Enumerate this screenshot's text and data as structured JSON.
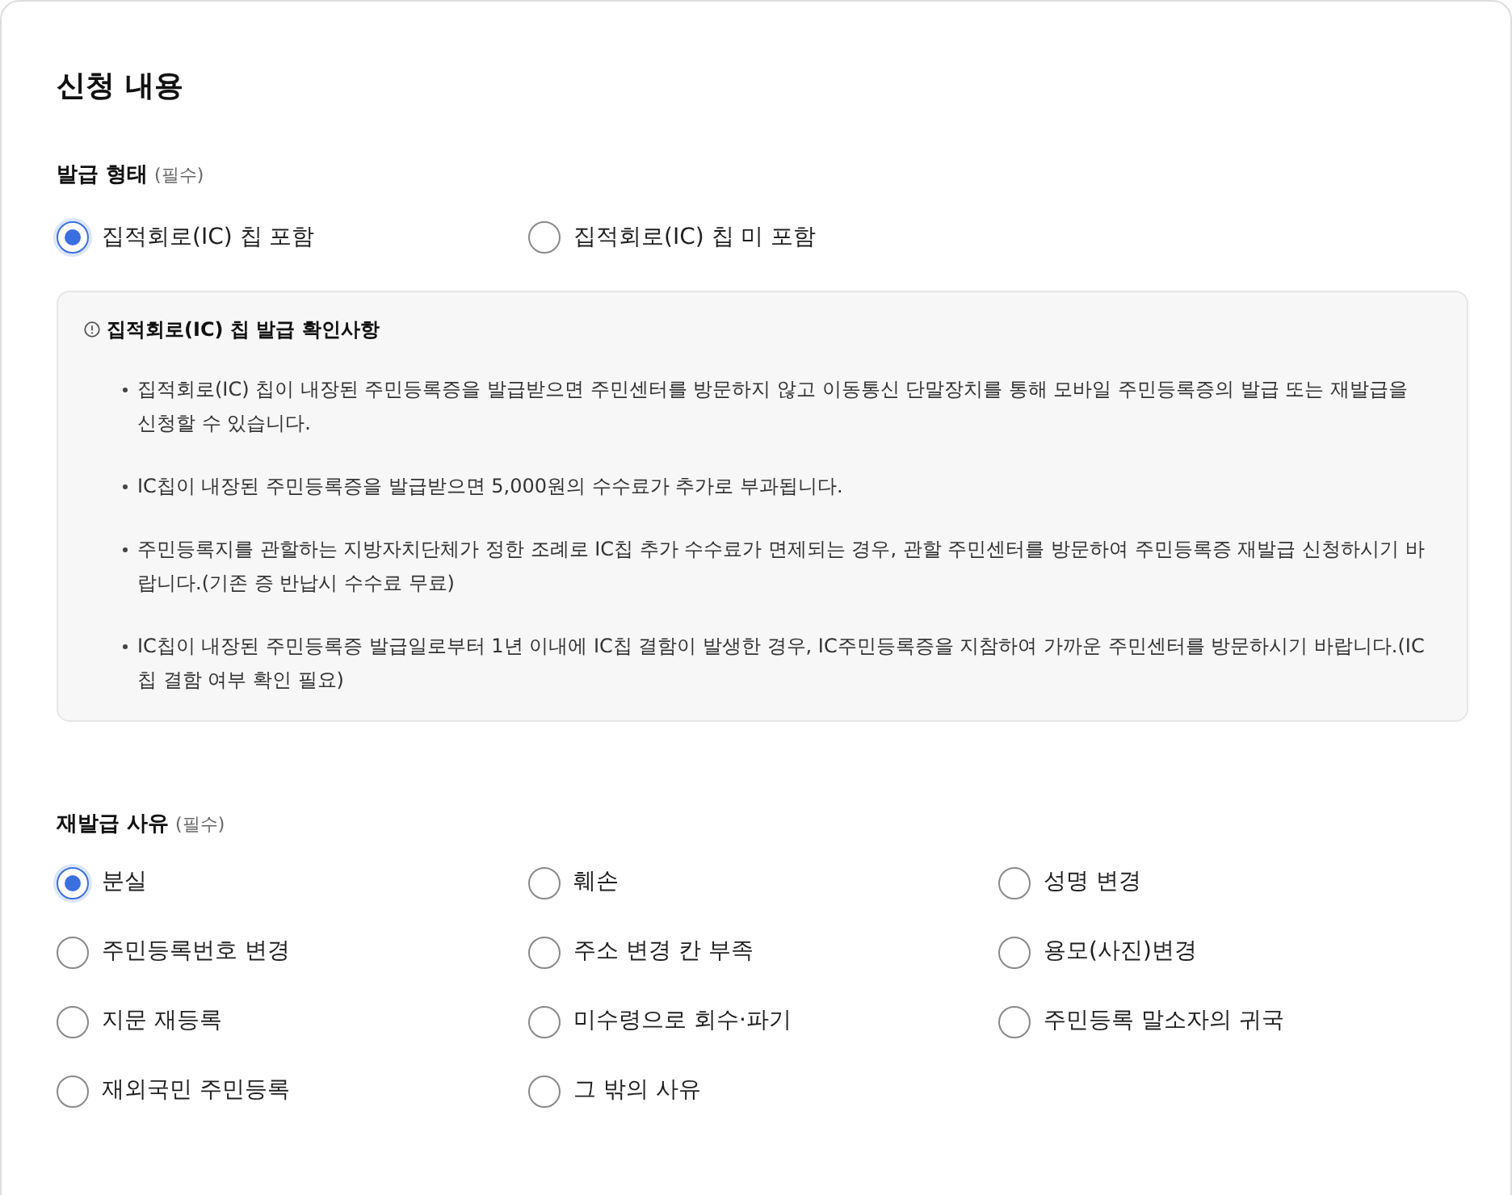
{
  "title": "신청 내용",
  "issue_type": {
    "label": "발급 형태",
    "required": "(필수)",
    "options": [
      {
        "label": "집적회로(IC) 칩 포함",
        "selected": true
      },
      {
        "label": "집적회로(IC) 칩 미 포함",
        "selected": false
      }
    ]
  },
  "notice": {
    "title": "집적회로(IC) 칩 발급 확인사항",
    "items": [
      "집적회로(IC) 칩이 내장된 주민등록증을 발급받으면 주민센터를 방문하지 않고 이동통신 단말장치를 통해 모바일 주민등록증의 발급 또는 재발급을 신청할 수 있습니다.",
      "IC칩이 내장된 주민등록증을 발급받으면 5,000원의 수수료가 추가로 부과됩니다.",
      "주민등록지를 관할하는 지방자치단체가 정한 조례로 IC칩 추가 수수료가 면제되는 경우, 관할 주민센터를 방문하여 주민등록증 재발급 신청하시기 바랍니다.(기존 증 반납시 수수료 무료)",
      "IC칩이 내장된 주민등록증 발급일로부터 1년 이내에 IC칩 결함이 발생한 경우, IC주민등록증을 지참하여 가까운 주민센터를 방문하시기 바랍니다.(IC칩 결함 여부 확인 필요)"
    ]
  },
  "reissue_reason": {
    "label": "재발급 사유",
    "required": "(필수)",
    "options": [
      {
        "label": "분실",
        "selected": true
      },
      {
        "label": "훼손",
        "selected": false
      },
      {
        "label": "성명 변경",
        "selected": false
      },
      {
        "label": "주민등록번호 변경",
        "selected": false
      },
      {
        "label": "주소 변경 칸 부족",
        "selected": false
      },
      {
        "label": "용모(사진)변경",
        "selected": false
      },
      {
        "label": "지문 재등록",
        "selected": false
      },
      {
        "label": "미수령으로 회수·파기",
        "selected": false
      },
      {
        "label": "주민등록 말소자의 귀국",
        "selected": false
      },
      {
        "label": "재외국민 주민등록",
        "selected": false
      },
      {
        "label": "그 밖의 사유",
        "selected": false
      }
    ]
  }
}
